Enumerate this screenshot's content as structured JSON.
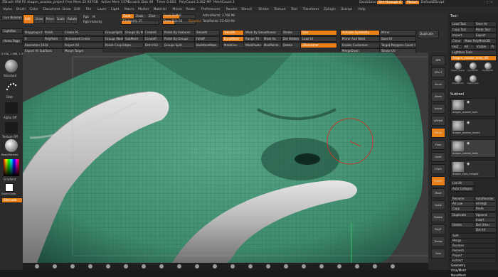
{
  "titlebar": {
    "app": "ZBrush 4R8 P2",
    "project": "dragon_ananke_project",
    "free_mem": "Free Mem 22.937GB",
    "active_mem": "Active Mem 1379",
    "scratch": "Scratch Disk 48",
    "timer": "Timer 0.003",
    "polycount": "PolyCount 3.362 MP",
    "meshcount": "MeshCount 3",
    "quicksave": "QuickSave",
    "see_through": "See-through 0",
    "menus": "Menus",
    "script": "DefaultZScript"
  },
  "menubar": [
    "Alpha",
    "Brush",
    "Color",
    "Document",
    "Draw",
    "Edit",
    "File",
    "Layer",
    "Light",
    "Macro",
    "Marker",
    "Material",
    "Movie",
    "Picker",
    "Preferences",
    "Render",
    "Stencil",
    "Stroke",
    "Texture",
    "Tool",
    "Transform",
    "Zplugin",
    "Zscript",
    "Help"
  ],
  "toolbar": {
    "lightbox": "LightBox",
    "live_boolean": "Live Boolean",
    "home_page": "Home Page",
    "zadd": "Zadd",
    "zsub": "Zsub",
    "zcut": "Zcut",
    "focal_shift": "Focal Shift 0",
    "draw_size": "Draw Size 64",
    "dynamic": "Dynamic",
    "z_intensity": "Z Intensity 25",
    "active_points": "ActivePoints: 3.766 Mil",
    "total_points": "TotalPoints: 23.924 Mil",
    "rgb_intensity": "Rgb Intensity",
    "m": "M",
    "rgb": "Rgb",
    "zero": "0",
    "polypaint": "PolyPaint",
    "edit": "Edit",
    "draw": "Draw",
    "move": "Move",
    "scale": "Scale",
    "rotate": "Rotate",
    "submesh": "SubMesh",
    "polish": "Polish",
    "polygroups_it": "Polygroups It",
    "groups_split": "GroupsSplit",
    "create_pc": "Create PC",
    "groups_by_normals": "Groups By Normals",
    "unmasked_center": "Unmasked Center",
    "groups_masked": "Groups Masked",
    "create_r": "CreateR",
    "create_s": "CreateS",
    "polish_features": "Polish By Features",
    "polish_groups": "Polish By Groups",
    "polish_crisp": "Polish Crisp Edges",
    "groups_split2": "Groups Split",
    "backface_mask": "BackfaceMask",
    "smooth": "Smooth",
    "mask_by_smoothness": "Mask By Smoothness",
    "range": "Range 70",
    "falloff": "Falloff",
    "mask_ao": "Mask Ao",
    "mask_cav": "MaskCav",
    "mask_peaks": "MaskPeaks",
    "stroke": "Stroke",
    "size": "Size",
    "del_hidden": "Del Hidden",
    "mod_points": "ModPoints",
    "delete": "Delete",
    "zremesher": "ZRemesher",
    "target_poly": "Target Polygons Count 10",
    "auto_symmetry": "Activate Symmetry",
    "mirror": "Mirror",
    "mirror_weld": "Mirror And Weld",
    "duplicate": "Duplicate",
    "load_ui": "Load UI",
    "save_ui": "Save UI",
    "stroke_uv": "Stroke UV",
    "merge_down": "MergeDown",
    "enable_customize": "Enable Customize",
    "poly_f": "PolyF",
    "resolution": "Resolution 1024",
    "project_all": "Project All",
    "dist": "Dist 0.02",
    "export_all": "Export All SubTools",
    "morph_target": "Morph Target",
    "smooth_brush": "Smooth",
    "dynamesh": "DynaMesh",
    "floor": "Floor",
    "pers": "Pers",
    "frame": "Frame"
  },
  "coord_readout": "0.938, 1.066, 1.357",
  "leftpanel": {
    "brush": "Standard",
    "stroke": "Dots",
    "alpha": "Alpha Off",
    "texture": "Texture Off",
    "material": "BasicMaterial",
    "gradient": "Gradient",
    "switch_color": "SwitchColor",
    "alternate": "Alternate"
  },
  "rightdock": [
    "BPR",
    "SPix 3",
    "Scroll",
    "Zoom",
    "Actual",
    "AAHalf",
    "Persp",
    "Floor",
    "Local",
    "LSym",
    "Frame",
    "Move",
    "Scale",
    "Rotate",
    "PolyF",
    "Transp",
    "Solo"
  ],
  "rightpanel": {
    "header": "Tool",
    "load_tool": "Load Tool",
    "save_as": "Save As",
    "copy_tool": "Copy Tool",
    "paste_tool": "Paste Tool",
    "import": "Import",
    "export": "Export",
    "clone": "Clone",
    "make_polymesh": "Make PolyMesh3D",
    "goz": "GoZ",
    "all": "All",
    "visible": "Visible",
    "r": "R",
    "lightbox_tools": "Lightbox Tools",
    "current_tool": "dragon_ananke_body_48",
    "tools": [
      "dragon_ananke",
      "Cylinder3D",
      "PolyMesh3D",
      "SimpleBrush",
      "dragon_eyes"
    ],
    "subtool_header": "Subtool",
    "subtools": [
      "dragon_ananke_horn",
      "dragon_ananke_mouth",
      "dragon_ananke_body",
      "dragon_eyes_merged"
    ],
    "list_all": "List All",
    "auto_collapse": "Auto Collapse",
    "rename": "Rename",
    "autoreorder": "AutoReorder",
    "all_low": "All Low",
    "all_high": "All High",
    "copy": "Copy",
    "paste": "Paste",
    "duplicate": "Duplicate",
    "append": "Append",
    "insert": "Insert",
    "delete": "Delete",
    "del_other": "Del Other",
    "del_all": "Del All",
    "split": "Split",
    "merge": "Merge",
    "boolean": "Boolean",
    "remesh": "Remesh",
    "project": "Project",
    "extract": "Extract",
    "geometry": "Geometry",
    "arraymesh": "ArrayMesh",
    "nanomesh": "NanoMesh"
  },
  "colors": {
    "accent": "#e8801c",
    "mesh": "#3f8a6e",
    "horn": "#bdbdbd"
  }
}
